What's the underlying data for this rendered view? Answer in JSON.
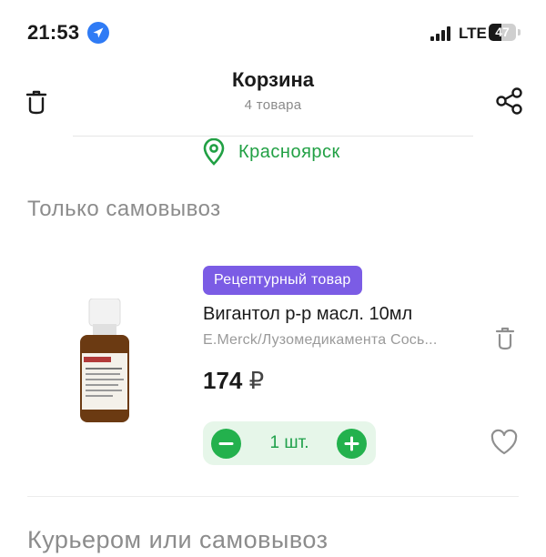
{
  "status_bar": {
    "time": "21:53",
    "network": "LTE",
    "battery": "47",
    "battery_level": 0.47
  },
  "header": {
    "title": "Корзина",
    "subtitle": "4 товара",
    "icons": [
      "trash-icon",
      "share-icon"
    ]
  },
  "city": {
    "name": "Красноярск",
    "icon": "location-pin-icon"
  },
  "sections": [
    {
      "title": "Только самовывоз"
    },
    {
      "title": "Курьером или самовывоз"
    }
  ],
  "product": {
    "badge": "Рецептурный товар",
    "name": "Вигантол р-р масл. 10мл",
    "manufacturer": "E.Merck/Лузомедикамента Сось...",
    "price": "174",
    "currency": "₽",
    "quantity_label": "1 шт."
  },
  "colors": {
    "accent_green": "#23b14d",
    "badge_purple": "#7b5ce5",
    "stepper_bg": "#e6f6e9"
  }
}
